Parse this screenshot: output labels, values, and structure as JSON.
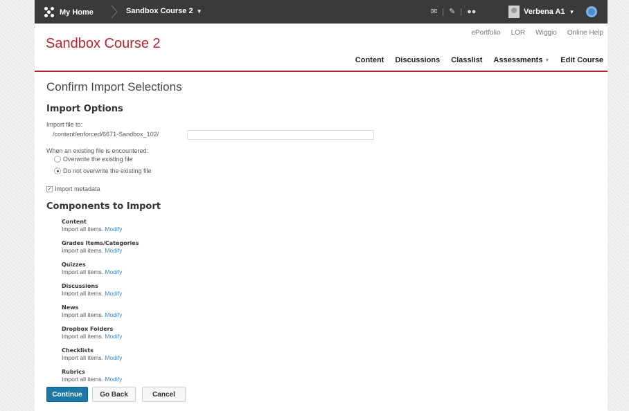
{
  "topbar": {
    "home_label": "My Home",
    "course_label": "Sandbox Course 2",
    "user_label": "Verbena A1"
  },
  "header": {
    "course_title": "Sandbox Course 2",
    "util_links": [
      "ePortfolio",
      "LOR",
      "Wiggio",
      "Online Help"
    ],
    "nav": {
      "content": "Content",
      "discussions": "Discussions",
      "classlist": "Classlist",
      "assessments": "Assessments",
      "edit_course": "Edit Course"
    }
  },
  "page": {
    "title": "Confirm Import Selections",
    "import_options_heading": "Import Options",
    "import_file_to_label": "Import file to:",
    "import_path": "/content/enforced/6671-Sandbox_102/",
    "import_path_value": "",
    "existing_file_label": "When an existing file is encountered:",
    "overwrite_label": "Overwrite the existing file",
    "no_overwrite_label": "Do not overwrite the existing file",
    "overwrite_selected": false,
    "import_metadata_label": "Import metadata",
    "import_metadata_checked": true,
    "components_heading": "Components to Import",
    "components": [
      {
        "name": "Content",
        "desc": "Import all items.",
        "modify": "Modify"
      },
      {
        "name": "Grades Items/Categories",
        "desc": "Import all items.",
        "modify": "Modify"
      },
      {
        "name": "Quizzes",
        "desc": "Import all items.",
        "modify": "Modify"
      },
      {
        "name": "Discussions",
        "desc": "Import all items.",
        "modify": "Modify"
      },
      {
        "name": "News",
        "desc": "Import all items.",
        "modify": "Modify"
      },
      {
        "name": "Dropbox Folders",
        "desc": "Import all items.",
        "modify": "Modify"
      },
      {
        "name": "Checklists",
        "desc": "Import all items.",
        "modify": "Modify"
      },
      {
        "name": "Rubrics",
        "desc": "Import all items.",
        "modify": "Modify"
      }
    ],
    "buttons": {
      "continue": "Continue",
      "go_back": "Go Back",
      "cancel": "Cancel"
    }
  },
  "colors": {
    "brand_red": "#b5262d",
    "primary_button": "#1b78a6",
    "link": "#3a8bc0",
    "topbar": "#3a3a3a"
  }
}
